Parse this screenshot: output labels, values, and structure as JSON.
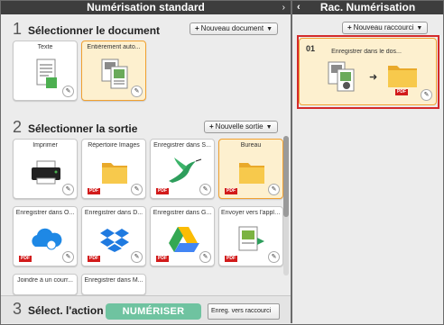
{
  "left_panel": {
    "title": "Numérisation standard",
    "section1": {
      "number": "1",
      "title": "Sélectionner le document",
      "button": "Nouveau document"
    },
    "documents": [
      {
        "label": "Texte",
        "selected": false
      },
      {
        "label": "Entièrement auto...",
        "selected": true
      }
    ],
    "section2": {
      "number": "2",
      "title": "Sélectionner la sortie",
      "button": "Nouvelle sortie"
    },
    "outputs": [
      {
        "label": "Imprimer",
        "pdf": false,
        "selected": false,
        "icon": "printer-icon"
      },
      {
        "label": "Répertoire Images",
        "pdf": true,
        "selected": false,
        "icon": "folder-icon"
      },
      {
        "label": "Enregistrer dans S...",
        "pdf": true,
        "selected": false,
        "icon": "bird-icon"
      },
      {
        "label": "Bureau",
        "pdf": true,
        "selected": true,
        "icon": "folder-icon"
      },
      {
        "label": "Enregistrer dans O...",
        "pdf": true,
        "selected": false,
        "icon": "cloud-icon"
      },
      {
        "label": "Enregistrer dans D...",
        "pdf": true,
        "selected": false,
        "icon": "dropbox-icon"
      },
      {
        "label": "Enregistrer dans G...",
        "pdf": true,
        "selected": false,
        "icon": "drive-icon"
      },
      {
        "label": "Envoyer vers l'appli...",
        "pdf": true,
        "selected": false,
        "icon": "app-icon"
      }
    ],
    "partial_row": [
      "Joindre à un courr...",
      "Enregistrer dans M..."
    ],
    "section3": {
      "number": "3",
      "title": "Sélect. l'action"
    },
    "scan_button": "NUMÉRISER",
    "save_shortcut_button": "Enreg. vers raccourci"
  },
  "right_panel": {
    "title": "Rac. Numérisation",
    "new_shortcut_button": "Nouveau raccourci",
    "shortcut": {
      "number": "01",
      "label": "Enregistrer dans le dos...",
      "pdf": true
    }
  },
  "colors": {
    "titlebar": "#3d3d3d",
    "selected_bg": "#fdf0cf",
    "scan_button": "#6fc3a0",
    "highlight_frame": "#d42b2b",
    "pdf_badge": "#d21b1b"
  }
}
